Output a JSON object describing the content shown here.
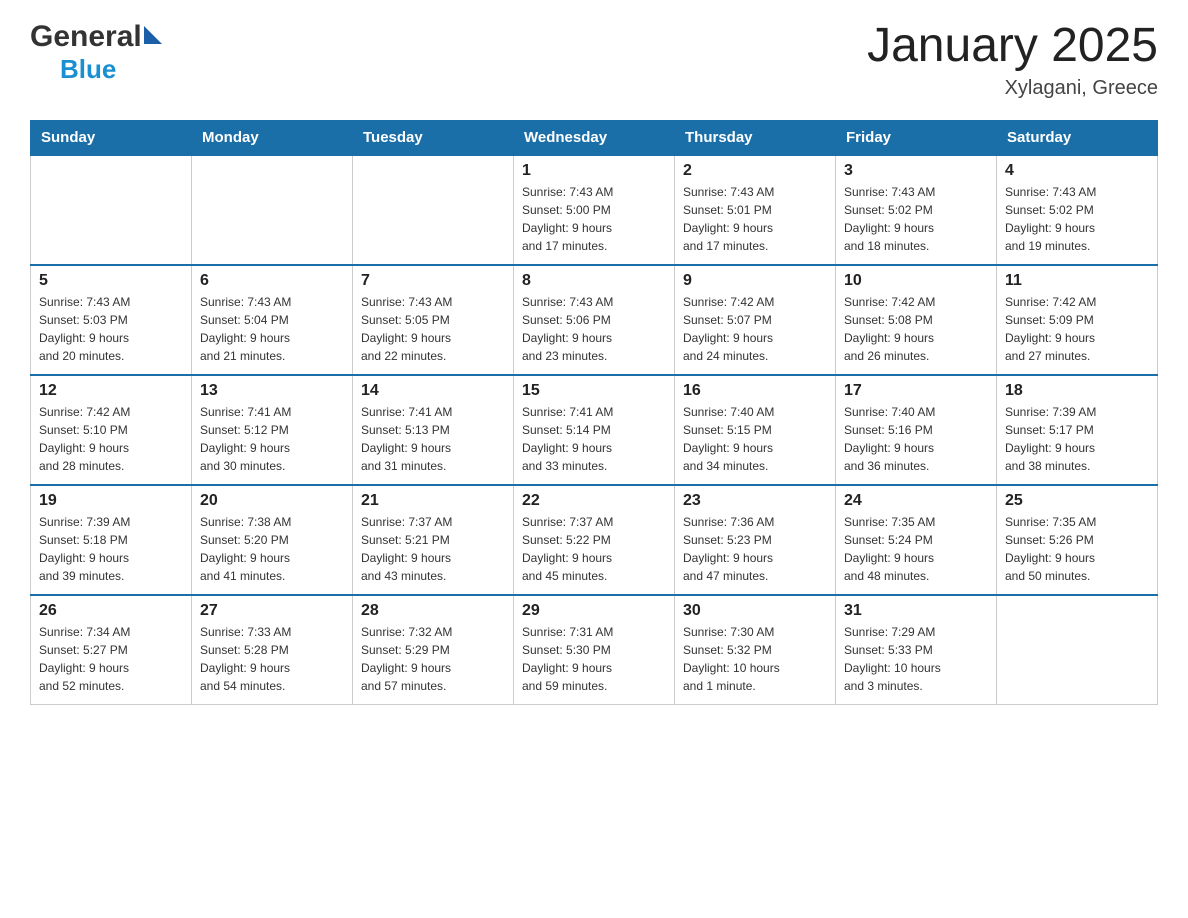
{
  "header": {
    "logo_general": "General",
    "logo_blue": "Blue",
    "title": "January 2025",
    "subtitle": "Xylagani, Greece"
  },
  "days_of_week": [
    "Sunday",
    "Monday",
    "Tuesday",
    "Wednesday",
    "Thursday",
    "Friday",
    "Saturday"
  ],
  "weeks": [
    [
      {
        "day": "",
        "info": ""
      },
      {
        "day": "",
        "info": ""
      },
      {
        "day": "",
        "info": ""
      },
      {
        "day": "1",
        "info": "Sunrise: 7:43 AM\nSunset: 5:00 PM\nDaylight: 9 hours\nand 17 minutes."
      },
      {
        "day": "2",
        "info": "Sunrise: 7:43 AM\nSunset: 5:01 PM\nDaylight: 9 hours\nand 17 minutes."
      },
      {
        "day": "3",
        "info": "Sunrise: 7:43 AM\nSunset: 5:02 PM\nDaylight: 9 hours\nand 18 minutes."
      },
      {
        "day": "4",
        "info": "Sunrise: 7:43 AM\nSunset: 5:02 PM\nDaylight: 9 hours\nand 19 minutes."
      }
    ],
    [
      {
        "day": "5",
        "info": "Sunrise: 7:43 AM\nSunset: 5:03 PM\nDaylight: 9 hours\nand 20 minutes."
      },
      {
        "day": "6",
        "info": "Sunrise: 7:43 AM\nSunset: 5:04 PM\nDaylight: 9 hours\nand 21 minutes."
      },
      {
        "day": "7",
        "info": "Sunrise: 7:43 AM\nSunset: 5:05 PM\nDaylight: 9 hours\nand 22 minutes."
      },
      {
        "day": "8",
        "info": "Sunrise: 7:43 AM\nSunset: 5:06 PM\nDaylight: 9 hours\nand 23 minutes."
      },
      {
        "day": "9",
        "info": "Sunrise: 7:42 AM\nSunset: 5:07 PM\nDaylight: 9 hours\nand 24 minutes."
      },
      {
        "day": "10",
        "info": "Sunrise: 7:42 AM\nSunset: 5:08 PM\nDaylight: 9 hours\nand 26 minutes."
      },
      {
        "day": "11",
        "info": "Sunrise: 7:42 AM\nSunset: 5:09 PM\nDaylight: 9 hours\nand 27 minutes."
      }
    ],
    [
      {
        "day": "12",
        "info": "Sunrise: 7:42 AM\nSunset: 5:10 PM\nDaylight: 9 hours\nand 28 minutes."
      },
      {
        "day": "13",
        "info": "Sunrise: 7:41 AM\nSunset: 5:12 PM\nDaylight: 9 hours\nand 30 minutes."
      },
      {
        "day": "14",
        "info": "Sunrise: 7:41 AM\nSunset: 5:13 PM\nDaylight: 9 hours\nand 31 minutes."
      },
      {
        "day": "15",
        "info": "Sunrise: 7:41 AM\nSunset: 5:14 PM\nDaylight: 9 hours\nand 33 minutes."
      },
      {
        "day": "16",
        "info": "Sunrise: 7:40 AM\nSunset: 5:15 PM\nDaylight: 9 hours\nand 34 minutes."
      },
      {
        "day": "17",
        "info": "Sunrise: 7:40 AM\nSunset: 5:16 PM\nDaylight: 9 hours\nand 36 minutes."
      },
      {
        "day": "18",
        "info": "Sunrise: 7:39 AM\nSunset: 5:17 PM\nDaylight: 9 hours\nand 38 minutes."
      }
    ],
    [
      {
        "day": "19",
        "info": "Sunrise: 7:39 AM\nSunset: 5:18 PM\nDaylight: 9 hours\nand 39 minutes."
      },
      {
        "day": "20",
        "info": "Sunrise: 7:38 AM\nSunset: 5:20 PM\nDaylight: 9 hours\nand 41 minutes."
      },
      {
        "day": "21",
        "info": "Sunrise: 7:37 AM\nSunset: 5:21 PM\nDaylight: 9 hours\nand 43 minutes."
      },
      {
        "day": "22",
        "info": "Sunrise: 7:37 AM\nSunset: 5:22 PM\nDaylight: 9 hours\nand 45 minutes."
      },
      {
        "day": "23",
        "info": "Sunrise: 7:36 AM\nSunset: 5:23 PM\nDaylight: 9 hours\nand 47 minutes."
      },
      {
        "day": "24",
        "info": "Sunrise: 7:35 AM\nSunset: 5:24 PM\nDaylight: 9 hours\nand 48 minutes."
      },
      {
        "day": "25",
        "info": "Sunrise: 7:35 AM\nSunset: 5:26 PM\nDaylight: 9 hours\nand 50 minutes."
      }
    ],
    [
      {
        "day": "26",
        "info": "Sunrise: 7:34 AM\nSunset: 5:27 PM\nDaylight: 9 hours\nand 52 minutes."
      },
      {
        "day": "27",
        "info": "Sunrise: 7:33 AM\nSunset: 5:28 PM\nDaylight: 9 hours\nand 54 minutes."
      },
      {
        "day": "28",
        "info": "Sunrise: 7:32 AM\nSunset: 5:29 PM\nDaylight: 9 hours\nand 57 minutes."
      },
      {
        "day": "29",
        "info": "Sunrise: 7:31 AM\nSunset: 5:30 PM\nDaylight: 9 hours\nand 59 minutes."
      },
      {
        "day": "30",
        "info": "Sunrise: 7:30 AM\nSunset: 5:32 PM\nDaylight: 10 hours\nand 1 minute."
      },
      {
        "day": "31",
        "info": "Sunrise: 7:29 AM\nSunset: 5:33 PM\nDaylight: 10 hours\nand 3 minutes."
      },
      {
        "day": "",
        "info": ""
      }
    ]
  ]
}
